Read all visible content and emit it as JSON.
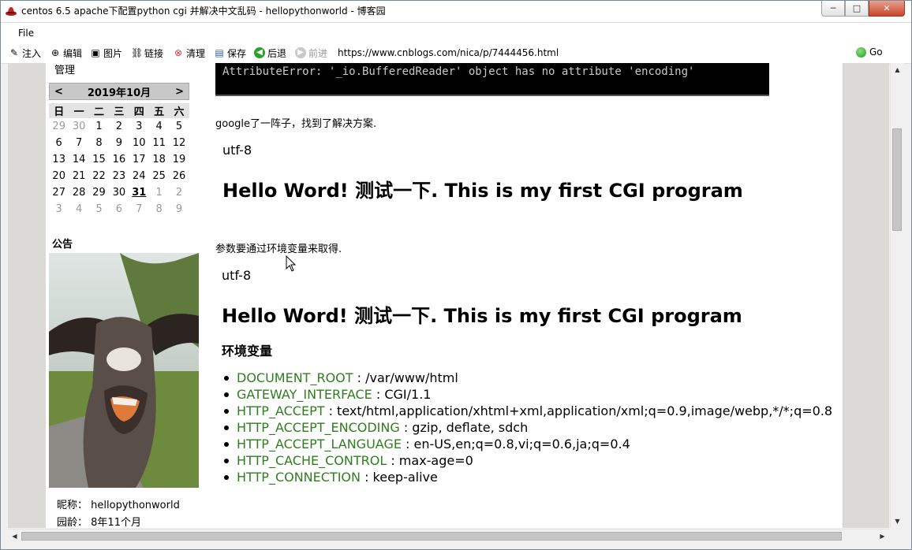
{
  "window": {
    "title": "centos 6.5 apache下配置python cgi 并解决中文乱码 - hellopythonworld - 博客园",
    "controls": {
      "minimize": "─",
      "maximize": "□",
      "close": "✕"
    }
  },
  "menu": {
    "file": "File"
  },
  "toolbar": {
    "inject": "注入",
    "edit": "编辑",
    "images": "图片",
    "links": "链接",
    "clear": "清理",
    "save": "保存",
    "back": "后退",
    "forward": "前进",
    "url": "https://www.cnblogs.com/nica/p/7444456.html",
    "go": "Go"
  },
  "sidebar": {
    "admin": "管理",
    "calendar": {
      "prev": "<",
      "next": ">",
      "month": "2019年10月",
      "weekdays": [
        "日",
        "一",
        "二",
        "三",
        "四",
        "五",
        "六"
      ],
      "weeks": [
        [
          "29",
          "30",
          "1",
          "2",
          "3",
          "4",
          "5"
        ],
        [
          "6",
          "7",
          "8",
          "9",
          "10",
          "11",
          "12"
        ],
        [
          "13",
          "14",
          "15",
          "16",
          "17",
          "18",
          "19"
        ],
        [
          "20",
          "21",
          "22",
          "23",
          "24",
          "25",
          "26"
        ],
        [
          "27",
          "28",
          "29",
          "30",
          "31",
          "1",
          "2"
        ],
        [
          "3",
          "4",
          "5",
          "6",
          "7",
          "8",
          "9"
        ]
      ]
    },
    "notice_title": "公告",
    "nickname_label": "昵称：",
    "nickname": "hellopythonworld",
    "age_label": "园龄：",
    "age": "8年11个月"
  },
  "content": {
    "code_line": "AttributeError: '_io.BufferedReader' object has no attribute 'encoding'",
    "p1": "google了一阵子，找到了解决方案.",
    "utf1": "utf-8",
    "hello1": "Hello Word! 测试一下. This is my first CGI program",
    "p2": "参数要通过环境变量来取得.",
    "utf2": "utf-8",
    "hello2": "Hello Word! 测试一下. This is my first CGI program",
    "env_heading": "环境变量",
    "env": [
      {
        "key": "DOCUMENT_ROOT",
        "sep": " : ",
        "value": "/var/www/html"
      },
      {
        "key": "GATEWAY_INTERFACE",
        "sep": " : ",
        "value": "CGI/1.1"
      },
      {
        "key": "HTTP_ACCEPT",
        "sep": " : ",
        "value": "text/html,application/xhtml+xml,application/xml;q=0.9,image/webp,*/*;q=0.8"
      },
      {
        "key": "HTTP_ACCEPT_ENCODING",
        "sep": " : ",
        "value": "gzip, deflate, sdch"
      },
      {
        "key": "HTTP_ACCEPT_LANGUAGE",
        "sep": " : ",
        "value": "en-US,en;q=0.8,vi;q=0.6,ja;q=0.4"
      },
      {
        "key": "HTTP_CACHE_CONTROL",
        "sep": " : ",
        "value": "max-age=0"
      },
      {
        "key": "HTTP_CONNECTION",
        "sep": " : ",
        "value": "keep-alive"
      }
    ]
  },
  "colors": {
    "env_key": "#2f7d1f",
    "close_button": "#c9462c",
    "go_icon": "#1f9d2a"
  }
}
